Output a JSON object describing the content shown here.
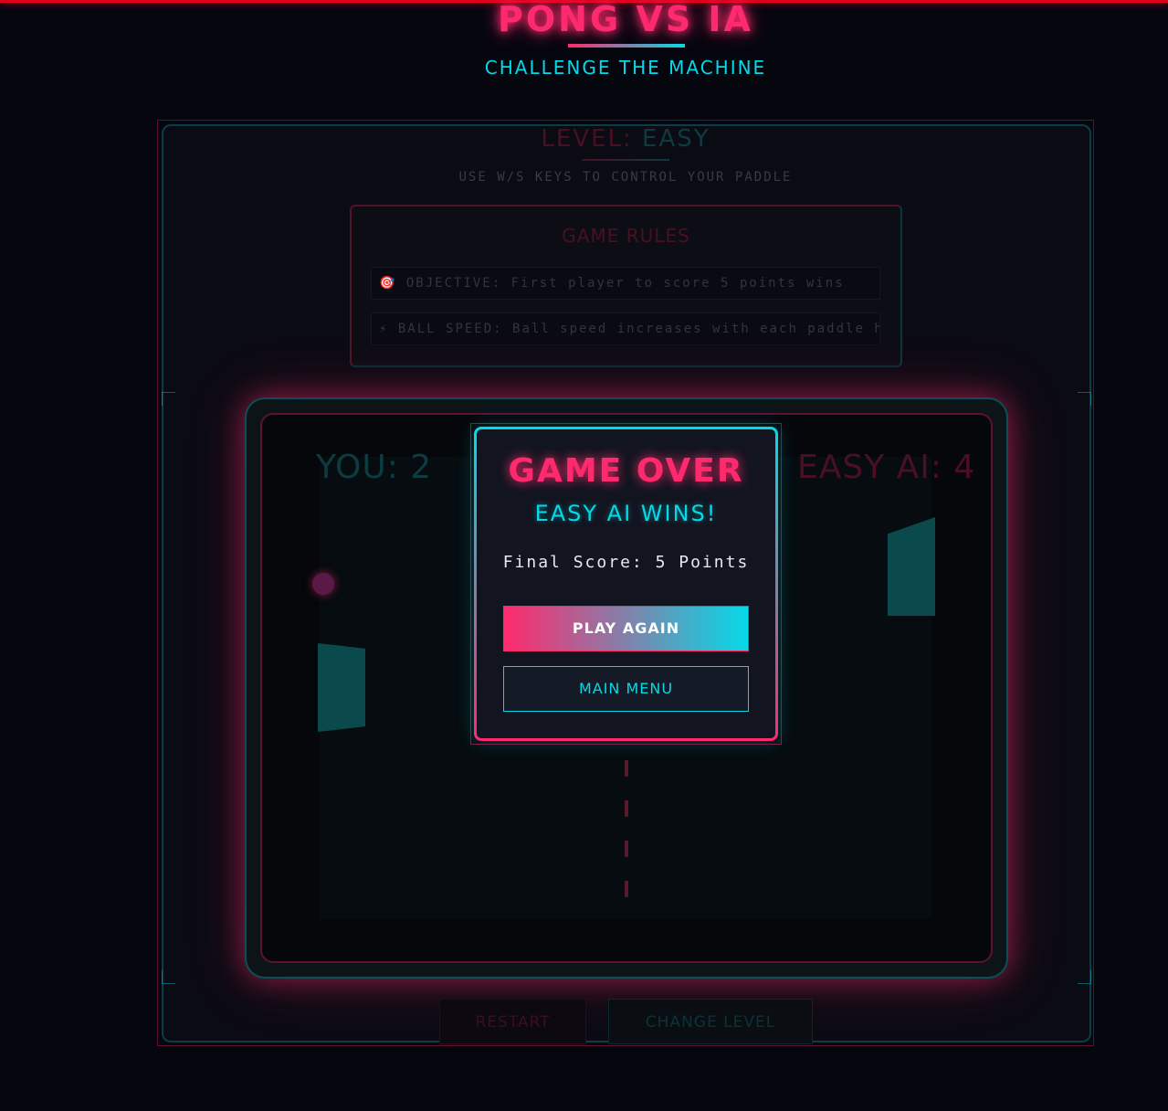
{
  "header": {
    "title": "PONG VS IA",
    "subtitle": "CHALLENGE THE MACHINE"
  },
  "level": {
    "label": "LEVEL:",
    "value": "EASY",
    "hint": "USE W/S KEYS TO CONTROL YOUR PADDLE"
  },
  "rules": {
    "title": "GAME RULES",
    "items": [
      {
        "icon": "🎯",
        "text": "OBJECTIVE: First player to score 5 points wins"
      },
      {
        "icon": "⚡",
        "text": "BALL SPEED: Ball speed increases with each paddle hit"
      }
    ]
  },
  "scoreboard": {
    "player": "YOU: 2",
    "ai": "EASY AI: 4"
  },
  "modal": {
    "title": "GAME OVER",
    "winner": "EASY AI WINS!",
    "final_score": "Final Score: 5 Points",
    "play_again": "PLAY AGAIN",
    "main_menu": "MAIN MENU"
  },
  "controls": {
    "restart": "RESTART",
    "change_level": "CHANGE LEVEL"
  },
  "colors": {
    "accent_pink": "#ff2a6d",
    "accent_cyan": "#05d9e8",
    "background": "#06060f"
  }
}
